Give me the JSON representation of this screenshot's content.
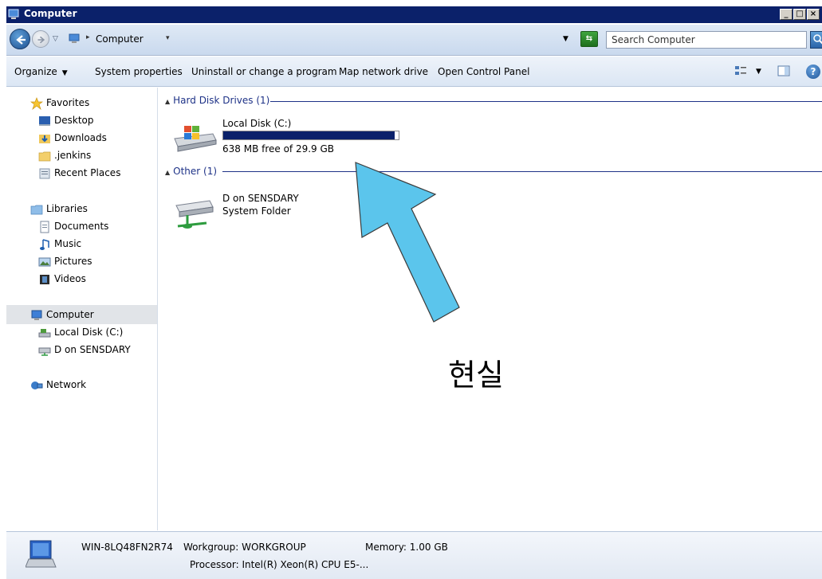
{
  "window": {
    "title": "Computer",
    "minimize_label": "_",
    "maximize_label": "□"
  },
  "address": {
    "path_label": "Computer",
    "search_placeholder": "Search Computer"
  },
  "toolbar": {
    "organize_label": "Organize",
    "system_properties_label": "System properties",
    "uninstall_label": "Uninstall or change a program",
    "map_drive_label": "Map network drive",
    "control_panel_label": "Open Control Panel",
    "help_label": "?"
  },
  "navpane": {
    "favorites": {
      "label": "Favorites",
      "items": [
        {
          "label": "Desktop"
        },
        {
          "label": "Downloads"
        },
        {
          "label": ".jenkins"
        },
        {
          "label": "Recent Places"
        }
      ]
    },
    "libraries": {
      "label": "Libraries",
      "items": [
        {
          "label": "Documents"
        },
        {
          "label": "Music"
        },
        {
          "label": "Pictures"
        },
        {
          "label": "Videos"
        }
      ]
    },
    "computer": {
      "label": "Computer",
      "items": [
        {
          "label": "Local Disk (C:)"
        },
        {
          "label": "D on SENSDARY"
        }
      ]
    },
    "network": {
      "label": "Network"
    }
  },
  "content": {
    "hdd_group": {
      "header": "Hard Disk Drives (1)",
      "drive_name": "Local Disk (C:)",
      "free_text": "638 MB free of 29.9 GB",
      "used_fraction": 0.979
    },
    "other_group": {
      "header": "Other (1)",
      "item_name": "D on SENSDARY",
      "item_type": "System Folder"
    }
  },
  "status": {
    "computer_name": "WIN-8LQ48FN2R74",
    "workgroup": "Workgroup: WORKGROUP",
    "memory": "Memory: 1.00 GB",
    "processor": "Processor: Intel(R) Xeon(R) CPU E5-..."
  },
  "annotation": {
    "text": "현실",
    "arrow_color": "#5bc5ec"
  }
}
